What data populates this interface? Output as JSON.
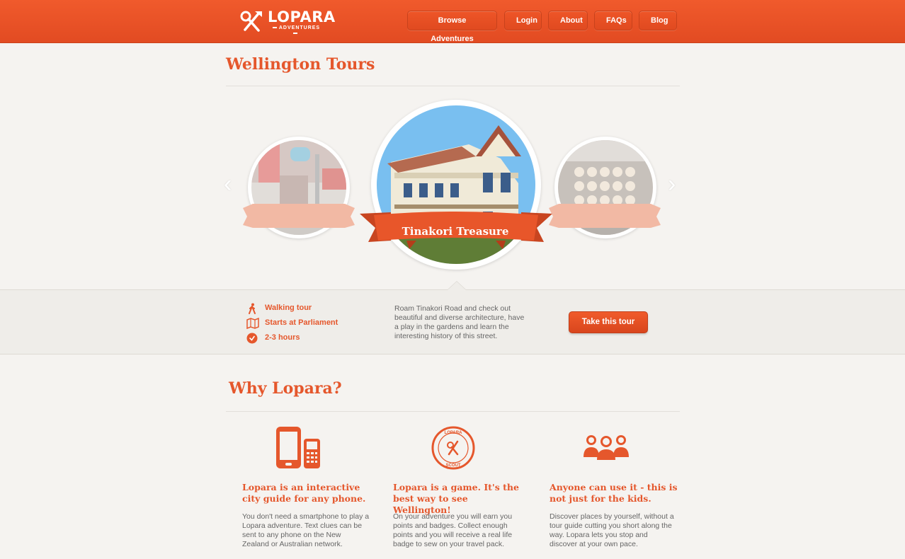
{
  "brand": {
    "name": "LOPARA",
    "tagline": "ADVENTURES",
    "color": "#e5572c"
  },
  "nav": [
    {
      "label": "Browse Adventures"
    },
    {
      "label": "Login"
    },
    {
      "label": "About"
    },
    {
      "label": "FAQs"
    },
    {
      "label": "Blog"
    }
  ],
  "page": {
    "title": "Wellington Tours"
  },
  "carousel": {
    "featured": {
      "title": "Tinakori Treasure"
    },
    "prev_icon": "chevron-left-icon",
    "next_icon": "chevron-right-icon"
  },
  "tour": {
    "facts": [
      {
        "icon": "walking-icon",
        "label": "Walking tour"
      },
      {
        "icon": "map-icon",
        "label": "Starts at Parliament"
      },
      {
        "icon": "clock-icon",
        "label": "2-3 hours"
      }
    ],
    "description": "Roam Tinakori Road and check out beautiful and diverse architecture, have a play in the gardens and learn the interesting history of this street.",
    "cta": "Take this tour"
  },
  "why": {
    "title": "Why Lopara?",
    "features": [
      {
        "icon": "phones-icon",
        "title": "Lopara is an interactive city guide for any phone.",
        "body": "You don't need a smartphone to play a Lopara adventure. Text clues can be sent to any phone on the New Zealand or Australian network."
      },
      {
        "icon": "scout-badge-icon",
        "badge_text": "LOPARA SCOUT",
        "title": "Lopara is a game. It's the best way to see Wellington!",
        "body": "On your adventure you will earn you points and badges. Collect enough points and you will receive a real life badge to sew on your travel pack."
      },
      {
        "icon": "people-icon",
        "title": "Anyone can use it - this is not just for the kids.",
        "body": "Discover places by yourself, without a tour guide cutting you short along the way. Lopara lets you stop and discover at your own pace."
      }
    ]
  }
}
